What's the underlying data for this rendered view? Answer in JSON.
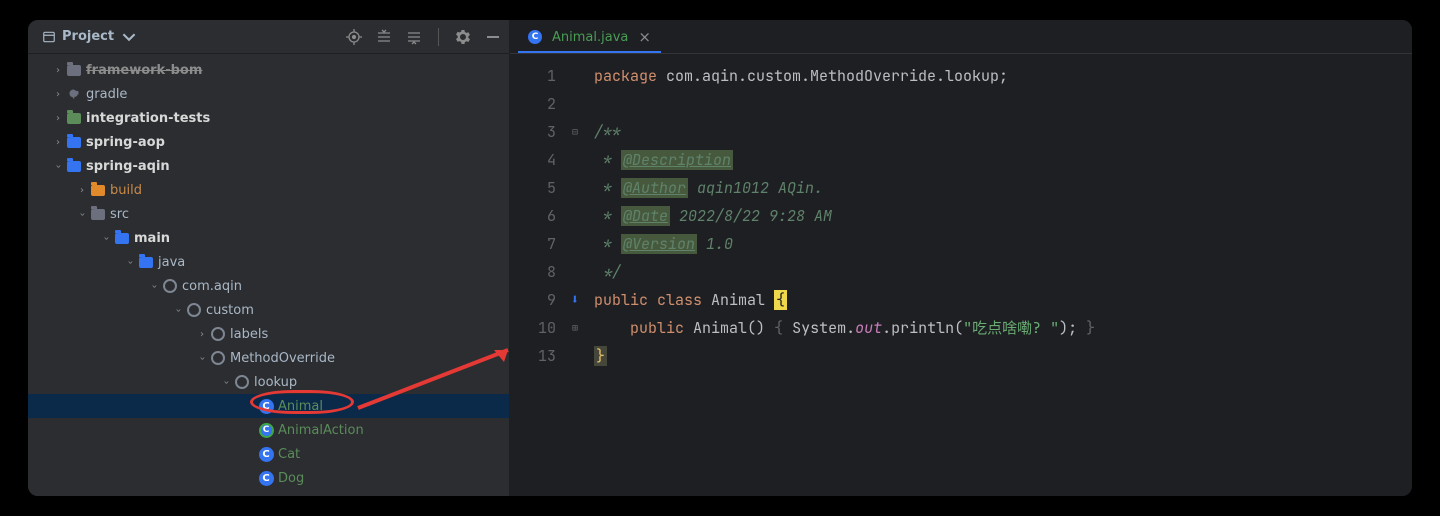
{
  "project_label": "Project",
  "tree": {
    "framework_bom": "framework-bom",
    "gradle": "gradle",
    "integration_tests": "integration-tests",
    "spring_aop": "spring-aop",
    "spring_aqin": "spring-aqin",
    "build": "build",
    "src": "src",
    "main": "main",
    "java": "java",
    "pkg": "com.aqin",
    "custom": "custom",
    "labels": "labels",
    "method_override": "MethodOverride",
    "lookup": "lookup",
    "animal": "Animal",
    "animal_action": "AnimalAction",
    "cat": "Cat",
    "dog": "Dog"
  },
  "tab": {
    "name": "Animal.java"
  },
  "gutter": [
    "1",
    "2",
    "3",
    "4",
    "5",
    "6",
    "7",
    "8",
    "9",
    "10",
    "13"
  ],
  "code": {
    "l1_kw": "package",
    "l1_rest": " com.aqin.custom.MethodOverride.lookup;",
    "l3": "/**",
    "l4_star": " * ",
    "l4_tag": "@Description",
    "l5_star": " * ",
    "l5_tag": "@Author",
    "l5_rest": " aqin1012 AQin.",
    "l6_star": " * ",
    "l6_tag": "@Date",
    "l6_rest": " 2022/8/22 9:28 AM",
    "l7_star": " * ",
    "l7_tag": "@Version",
    "l7_rest": " 1.0",
    "l8": " */",
    "l9_public": "public",
    "l9_class": " class ",
    "l9_name": "Animal ",
    "l9_brace": "{",
    "l10_pad": "    ",
    "l10_public": "public",
    "l10_ctor": " Animal() ",
    "l10_ob": "{ ",
    "l10_sys": "System.",
    "l10_out": "out",
    "l10_rest": ".println(",
    "l10_str": "\"吃点啥嘞? \"",
    "l10_close": "); ",
    "l10_cb": "}",
    "l13": "}"
  }
}
